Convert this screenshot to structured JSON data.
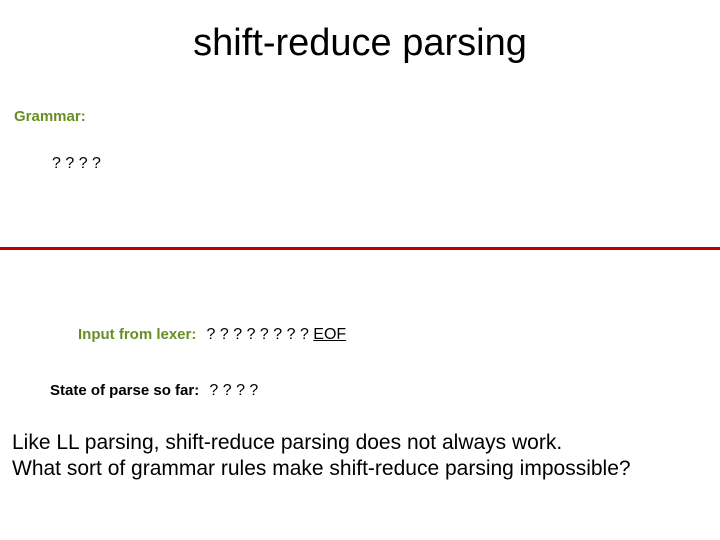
{
  "title": "shift-reduce parsing",
  "grammar": {
    "label": "Grammar:",
    "content": "? ? ? ?"
  },
  "input": {
    "label": "Input from lexer:",
    "value_prefix": "? ? ? ?  ? ? ? ? ",
    "eof": "EOF"
  },
  "state": {
    "label": "State of parse so far:",
    "value": "? ? ? ?"
  },
  "body": {
    "line1": "Like LL parsing, shift-reduce parsing does not always work.",
    "line2": "What sort of grammar rules make shift-reduce parsing impossible?"
  }
}
